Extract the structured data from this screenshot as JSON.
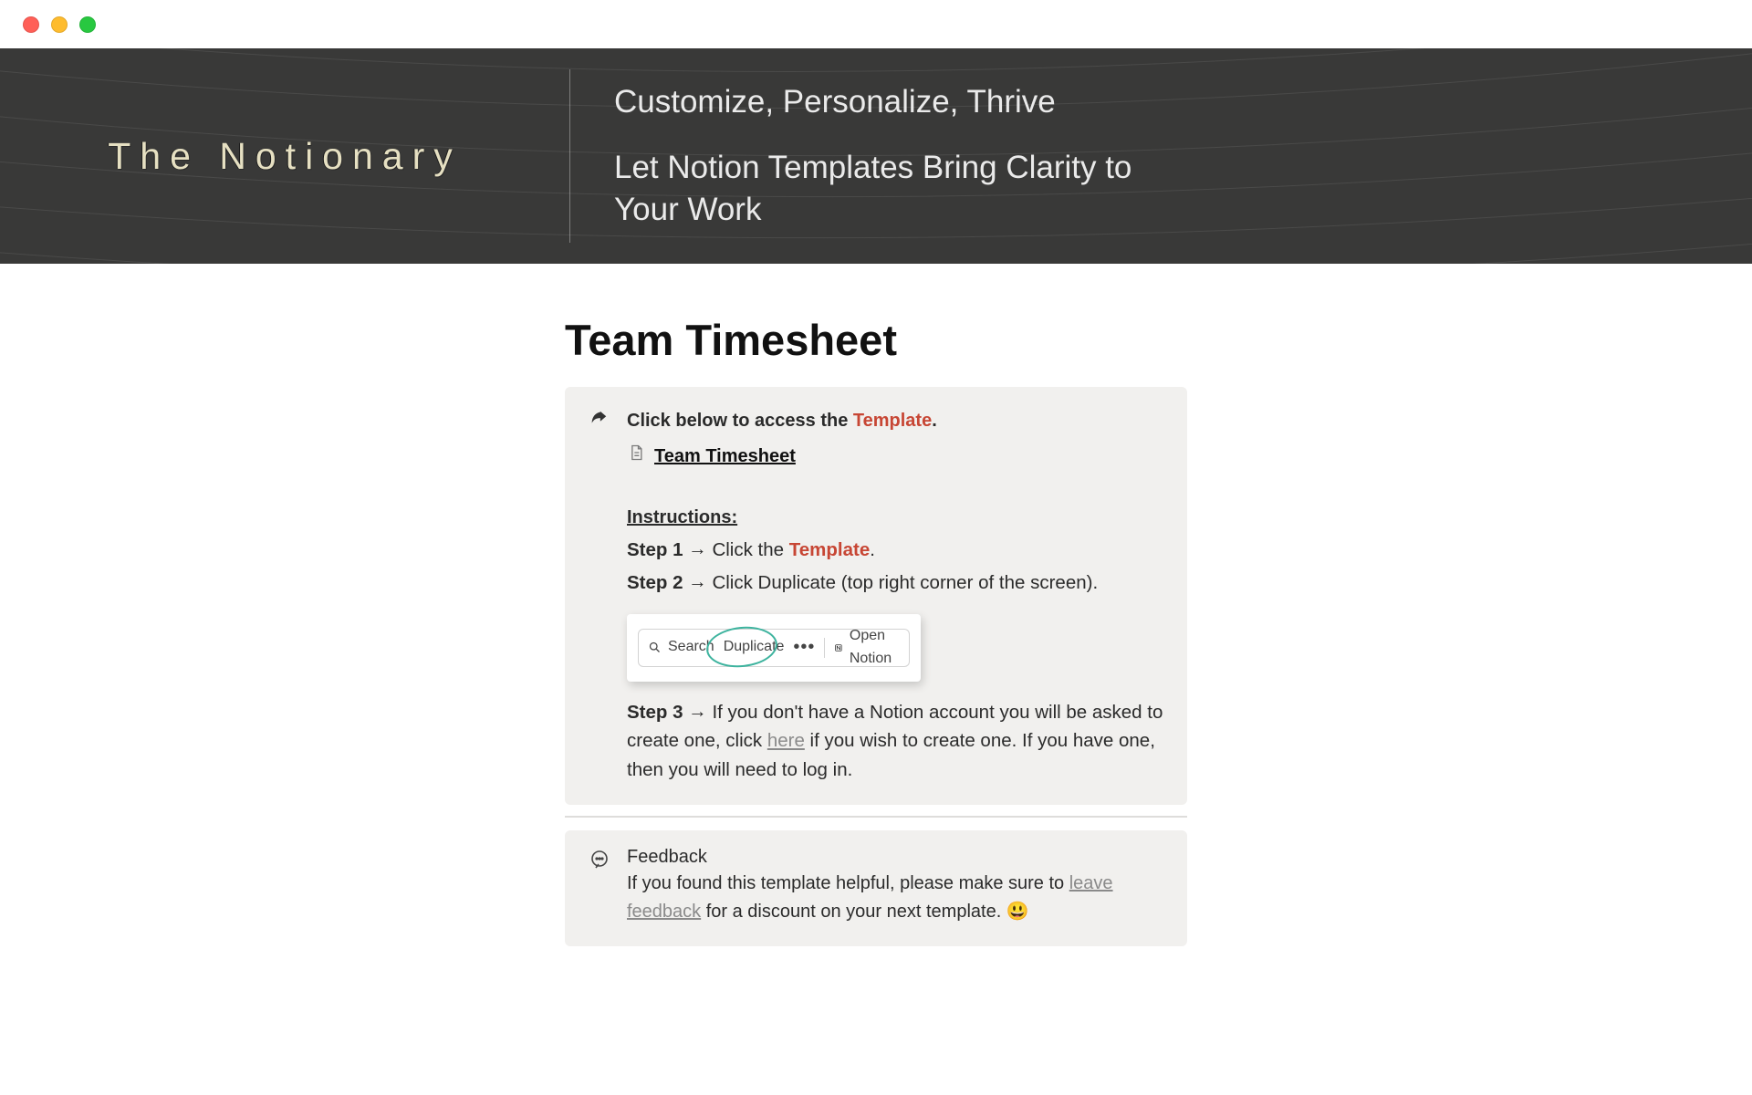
{
  "hero": {
    "brand": "The Notionary",
    "headline": "Customize, Personalize, Thrive",
    "sub": "Let Notion Templates Bring Clarity to Your Work"
  },
  "page": {
    "title": "Team Timesheet"
  },
  "callout": {
    "intro_prefix": "Click below to access the ",
    "intro_template_word": "Template",
    "intro_suffix": ".",
    "template_link_label": "Team Timesheet",
    "instructions_heading": "Instructions:",
    "step1_label": "Step 1",
    "step1_text": "Click the ",
    "step1_template_word": "Template",
    "step1_suffix": ".",
    "step2_label": "Step 2",
    "step2_text": "Click Duplicate (top right corner of the screen).",
    "toolbar": {
      "search": "Search",
      "duplicate": "Duplicate",
      "open_notion": "Open Notion"
    },
    "step3_label": "Step 3",
    "step3_prefix": "If you don't have a Notion account you will be asked to create one, click ",
    "step3_here": "here",
    "step3_suffix": " if you wish to create one. If you have one, then you will need to log in."
  },
  "feedback": {
    "title": "Feedback",
    "body_prefix": "If you found this template helpful, please make sure to ",
    "leave_feedback": "leave feedback",
    "body_suffix": " for a discount on your next template. ",
    "emoji": "😃"
  }
}
